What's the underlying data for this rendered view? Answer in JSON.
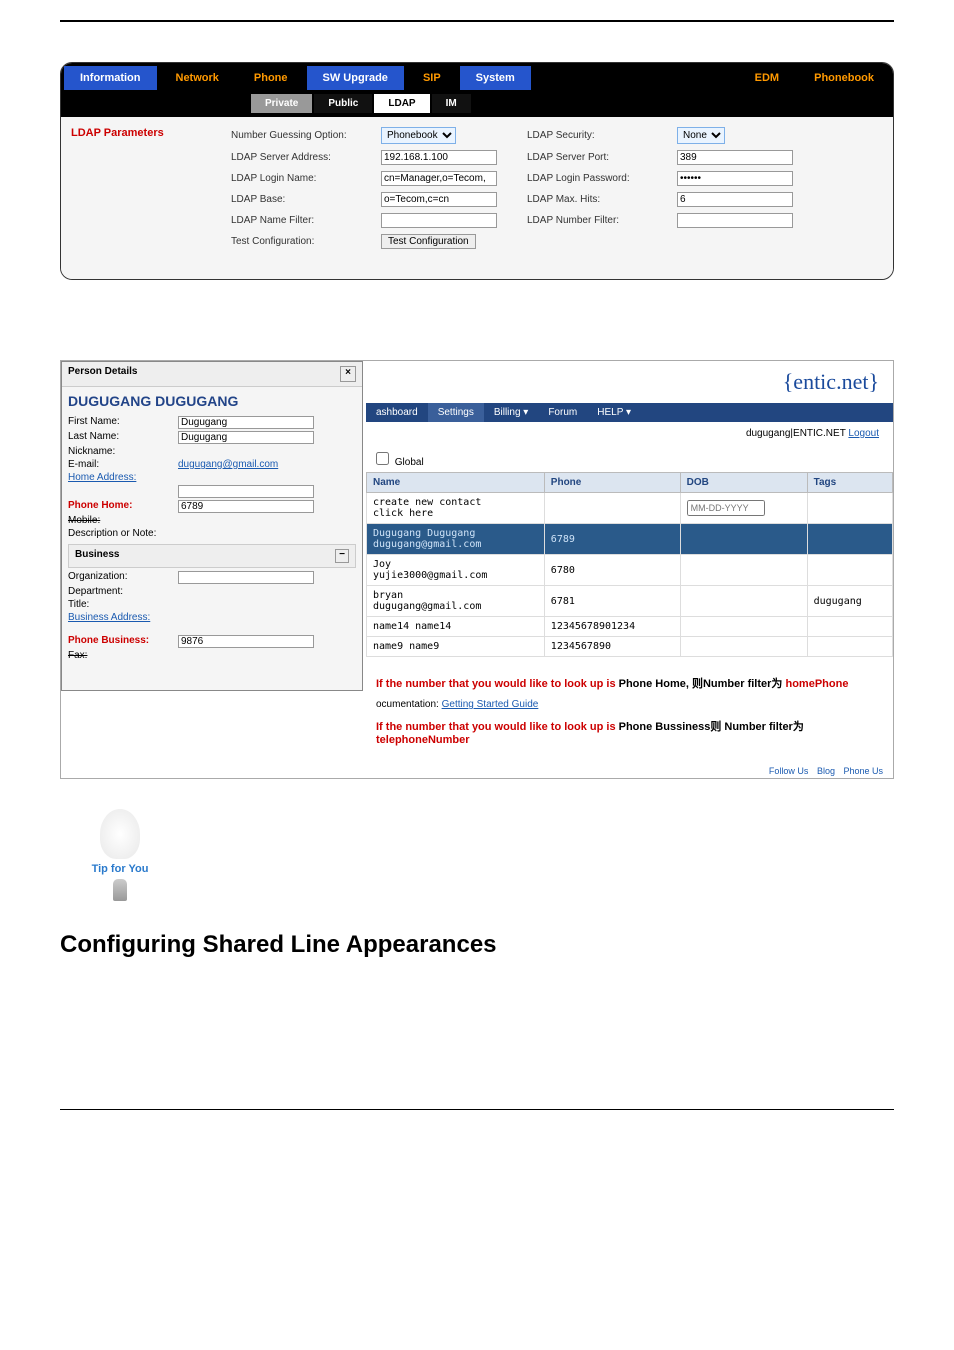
{
  "panel1": {
    "main_tabs": [
      "Information",
      "Network",
      "Phone",
      "SW Upgrade",
      "SIP",
      "System",
      "EDM",
      "Phonebook"
    ],
    "sub_tabs": [
      "Private",
      "Public",
      "LDAP",
      "IM"
    ],
    "sidebar_title": "LDAP Parameters",
    "fields_left": {
      "number_guessing_label": "Number Guessing Option:",
      "number_guessing_value": "Phonebook",
      "server_addr_label": "LDAP Server Address:",
      "server_addr_value": "192.168.1.100",
      "login_name_label": "LDAP Login Name:",
      "login_name_value": "cn=Manager,o=Tecom,",
      "base_label": "LDAP Base:",
      "base_value": "o=Tecom,c=cn",
      "name_filter_label": "LDAP Name Filter:",
      "name_filter_value": "",
      "test_config_label": "Test Configuration:",
      "test_config_button": "Test Configuration"
    },
    "fields_right": {
      "security_label": "LDAP Security:",
      "security_value": "None",
      "server_port_label": "LDAP Server Port:",
      "server_port_value": "389",
      "login_pw_label": "LDAP Login Password:",
      "login_pw_value": "••••••",
      "max_hits_label": "LDAP Max. Hits:",
      "max_hits_value": "6",
      "number_filter_label": "LDAP Number Filter:",
      "number_filter_value": ""
    }
  },
  "panel2": {
    "brand": "{entic.net}",
    "popup": {
      "header": "Person Details",
      "title": "DUGUGANG DUGUGANG",
      "first_name_label": "First Name:",
      "first_name_value": "Dugugang",
      "last_name_label": "Last Name:",
      "last_name_value": "Dugugang",
      "nickname_label": "Nickname:",
      "nickname_value": "",
      "email_label": "E-mail:",
      "email_value": "dugugang@gmail.com",
      "home_addr_label": "Home Address:",
      "phone_home_label": "Phone Home:",
      "phone_home_value": "6789",
      "mobile_label": "Mobile:",
      "desc_label": "Description or Note:",
      "business_section": "Business",
      "org_label": "Organization:",
      "dept_label": "Department:",
      "title_label": "Title:",
      "bus_addr_label": "Business Address:",
      "phone_bus_label": "Phone Business:",
      "phone_bus_value": "9876",
      "fax_label": "Fax:"
    },
    "app_tabs": [
      "ashboard",
      "Settings",
      "Billing ▾",
      "Forum",
      "HELP ▾"
    ],
    "user_text": "dugugang|ENTIC.NET",
    "logout": "Logout",
    "global_label": "Global",
    "table_headers": [
      "Name",
      "Phone",
      "DOB",
      "Tags"
    ],
    "dob_placeholder": "MM-DD-YYYY",
    "rows": [
      {
        "name1": "create new contact",
        "name2": "click here",
        "phone": "",
        "tags": ""
      },
      {
        "name1": "Dugugang Dugugang",
        "name2": "dugugang@gmail.com",
        "phone": "6789",
        "tags": ""
      },
      {
        "name1": "Joy",
        "name2": "yujie3000@gmail.com",
        "phone": "6780",
        "tags": ""
      },
      {
        "name1": "bryan",
        "name2": "dugugang@gmail.com",
        "phone": "6781",
        "tags": "dugugang"
      },
      {
        "name1": "name14 name14",
        "name2": "",
        "phone": "12345678901234",
        "tags": ""
      },
      {
        "name1": "name9 name9",
        "name2": "",
        "phone": "1234567890",
        "tags": ""
      }
    ],
    "doc_link_prefix": "ocumentation: ",
    "doc_link": "Getting Started Guide",
    "footer": {
      "follow": "Follow Us",
      "blog": "Blog",
      "phone": "Phone Us"
    }
  },
  "annotations": {
    "line1_prefix": "If the number that you would like to look up is ",
    "line1_mid1": "Phone Home",
    "line1_mid2": ", 则Number filter为 ",
    "line1_end": "homePhone",
    "line2_prefix": "If the number that you would like to look up is ",
    "line2_mid1": "Phone Bussiness",
    "line2_mid2": "则 Number filter为",
    "line2_end": "telephoneNumber"
  },
  "tip_label": "Tip for You",
  "heading": "Configuring Shared Line Appearances"
}
